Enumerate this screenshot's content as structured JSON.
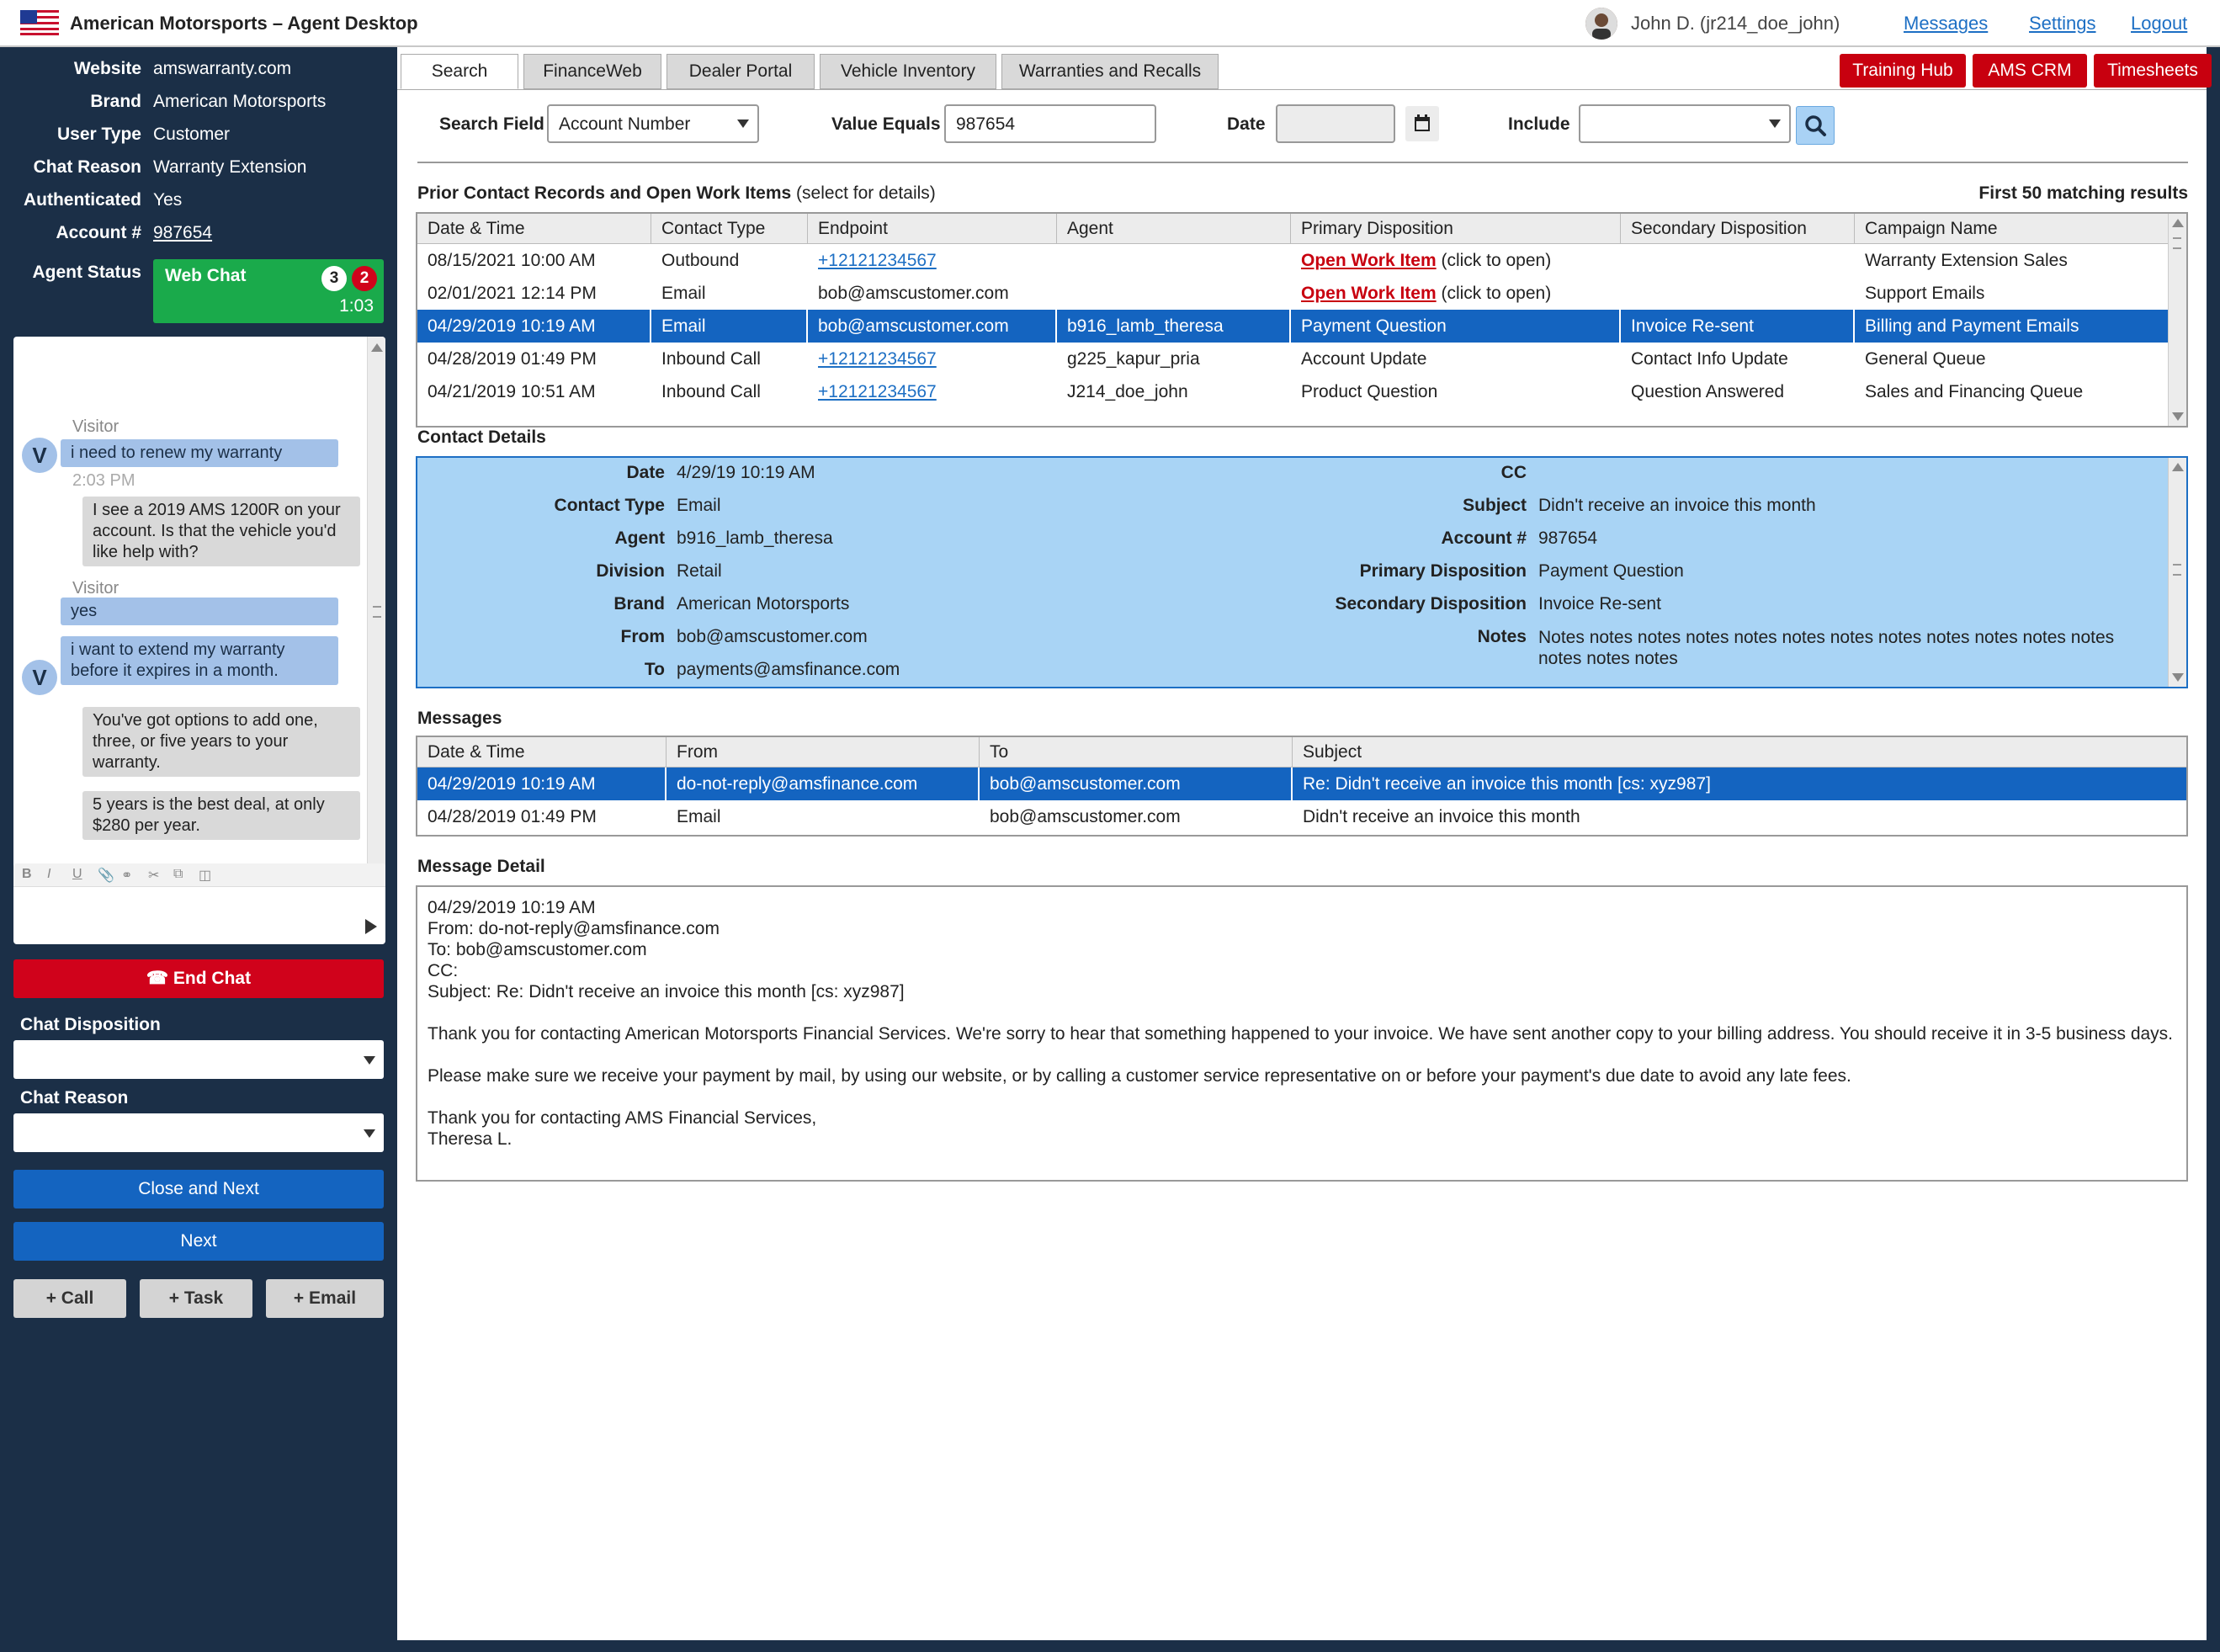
{
  "app": {
    "title": "American Motorsports – Agent Desktop",
    "user": "John D. (jr214_doe_john)",
    "links": [
      "Messages",
      "Settings",
      "Logout"
    ]
  },
  "customer": {
    "fields": [
      {
        "label": "Website",
        "value": "amswarranty.com"
      },
      {
        "label": "Brand",
        "value": "American Motorsports"
      },
      {
        "label": "User Type",
        "value": "Customer"
      },
      {
        "label": "Chat Reason",
        "value": "Warranty Extension"
      },
      {
        "label": "Authenticated",
        "value": "Yes"
      },
      {
        "label": "Account #",
        "value": "987654"
      }
    ],
    "agent_status_label": "Agent Status",
    "status": {
      "label": "Web Chat",
      "count_a": "3",
      "count_b": "2",
      "timer": "1:03"
    }
  },
  "chat": {
    "messages": [
      {
        "who": "Visitor",
        "text": "i need to renew my warranty",
        "time": "2:03 PM"
      },
      {
        "who": "Agent",
        "text": "I see a 2019 AMS 1200R on your account. Is that the vehicle you'd like help with?"
      },
      {
        "who": "Visitor",
        "text": "yes"
      },
      {
        "who": "Visitor",
        "text": "i want to extend my warranty before it expires in a month."
      },
      {
        "who": "Agent",
        "text": "You've got options to add one, three, or five years to your warranty."
      },
      {
        "who": "Agent",
        "text": "5 years is the best deal, at only $280 per year."
      }
    ],
    "avatar_letter": "V",
    "toolbar": [
      "B",
      "I",
      "U"
    ]
  },
  "sidebar": {
    "end_chat": "End Chat",
    "chat_disposition": "Chat Disposition",
    "chat_reason": "Chat Reason",
    "close_next": "Close and Next",
    "next": "Next",
    "add_call": "+ Call",
    "add_task": "+ Task",
    "add_email": "+ Email"
  },
  "tabs": [
    "Search",
    "FinanceWeb",
    "Dealer Portal",
    "Vehicle Inventory",
    "Warranties and Recalls"
  ],
  "top_buttons": [
    "Training Hub",
    "AMS CRM",
    "Timesheets"
  ],
  "search": {
    "field_label": "Search Field",
    "field_value": "Account Number",
    "value_label": "Value Equals",
    "value": "987654",
    "date_label": "Date",
    "include_label": "Include"
  },
  "prior": {
    "title": "Prior Contact Records and Open Work Items",
    "subtitle": "(select for details)",
    "results": "First 50 matching results",
    "columns": [
      "Date & Time",
      "Contact Type",
      "Endpoint",
      "Agent",
      "Primary Disposition",
      "Secondary Disposition",
      "Campaign Name"
    ],
    "rows": [
      {
        "dt": "08/15/2021 10:00 AM",
        "type": "Outbound",
        "endpoint": "+12121234567",
        "agent": "",
        "primary": "Open Work Item",
        "primary_suffix": "(click to open)",
        "secondary": "",
        "campaign": "Warranty Extension Sales"
      },
      {
        "dt": "02/01/2021 12:14 PM",
        "type": "Email",
        "endpoint": "bob@amscustomer.com",
        "agent": "",
        "primary": "Open Work Item",
        "primary_suffix": "(click to open)",
        "secondary": "",
        "campaign": "Support Emails"
      },
      {
        "dt": "04/29/2019 10:19 AM",
        "type": "Email",
        "endpoint": "bob@amscustomer.com",
        "agent": "b916_lamb_theresa",
        "primary": "Payment Question",
        "primary_suffix": "",
        "secondary": "Invoice Re-sent",
        "campaign": "Billing and Payment Emails"
      },
      {
        "dt": "04/28/2019 01:49 PM",
        "type": "Inbound Call",
        "endpoint": "+12121234567",
        "agent": "g225_kapur_pria",
        "primary": "Account Update",
        "primary_suffix": "",
        "secondary": "Contact Info Update",
        "campaign": "General Queue"
      },
      {
        "dt": "04/21/2019 10:51 AM",
        "type": "Inbound Call",
        "endpoint": "+12121234567",
        "agent": "J214_doe_john",
        "primary": "Product Question",
        "primary_suffix": "",
        "secondary": "Question Answered",
        "campaign": "Sales and Financing Queue"
      }
    ]
  },
  "details": {
    "title": "Contact Details",
    "left": [
      {
        "label": "Date",
        "value": "4/29/19 10:19 AM"
      },
      {
        "label": "Contact Type",
        "value": "Email"
      },
      {
        "label": "Agent",
        "value": "b916_lamb_theresa"
      },
      {
        "label": "Division",
        "value": "Retail"
      },
      {
        "label": "Brand",
        "value": "American Motorsports"
      },
      {
        "label": "From",
        "value": "bob@amscustomer.com"
      },
      {
        "label": "To",
        "value": "payments@amsfinance.com"
      }
    ],
    "right": [
      {
        "label": "CC",
        "value": ""
      },
      {
        "label": "Subject",
        "value": "Didn't receive an invoice this month"
      },
      {
        "label": "Account #",
        "value": "987654"
      },
      {
        "label": "Primary Disposition",
        "value": "Payment Question"
      },
      {
        "label": "Secondary Disposition",
        "value": "Invoice Re-sent"
      },
      {
        "label": "Notes",
        "value": "Notes notes notes notes notes notes notes notes notes notes notes notes notes notes notes"
      }
    ]
  },
  "messages": {
    "title": "Messages",
    "columns": [
      "Date & Time",
      "From",
      "To",
      "Subject"
    ],
    "rows": [
      {
        "dt": "04/29/2019 10:19 AM",
        "from": "do-not-reply@amsfinance.com",
        "to": "bob@amscustomer.com",
        "subject": "Re: Didn't receive an invoice this month [cs: xyz987]"
      },
      {
        "dt": "04/28/2019 01:49 PM",
        "from": "Email",
        "to": "bob@amscustomer.com",
        "subject": "Didn't receive an invoice this month"
      }
    ]
  },
  "message_detail": {
    "title": "Message Detail",
    "header_lines": [
      "04/29/2019 10:19 AM",
      "From: do-not-reply@amsfinance.com",
      "To: bob@amscustomer.com",
      "CC:",
      "Subject: Re: Didn't receive an invoice this month [cs: xyz987]"
    ],
    "para1": "Thank you for contacting American Motorsports Financial Services. We're sorry to hear that something happened to your invoice. We have sent another copy to your billing address. You should receive it in 3-5 business days.",
    "para2": "Please make sure we receive your payment by mail, by using our website, or by calling a customer service representative on or before your payment's due date to avoid any late fees.",
    "sign1": "Thank you for contacting AMS Financial Services,",
    "sign2": "Theresa L."
  },
  "colors": {
    "navy": "#1b2f47",
    "selected_blue": "#1464c0",
    "red": "#c8000f",
    "green": "#1aaa4b",
    "detail_blue": "#a9d4f5"
  }
}
